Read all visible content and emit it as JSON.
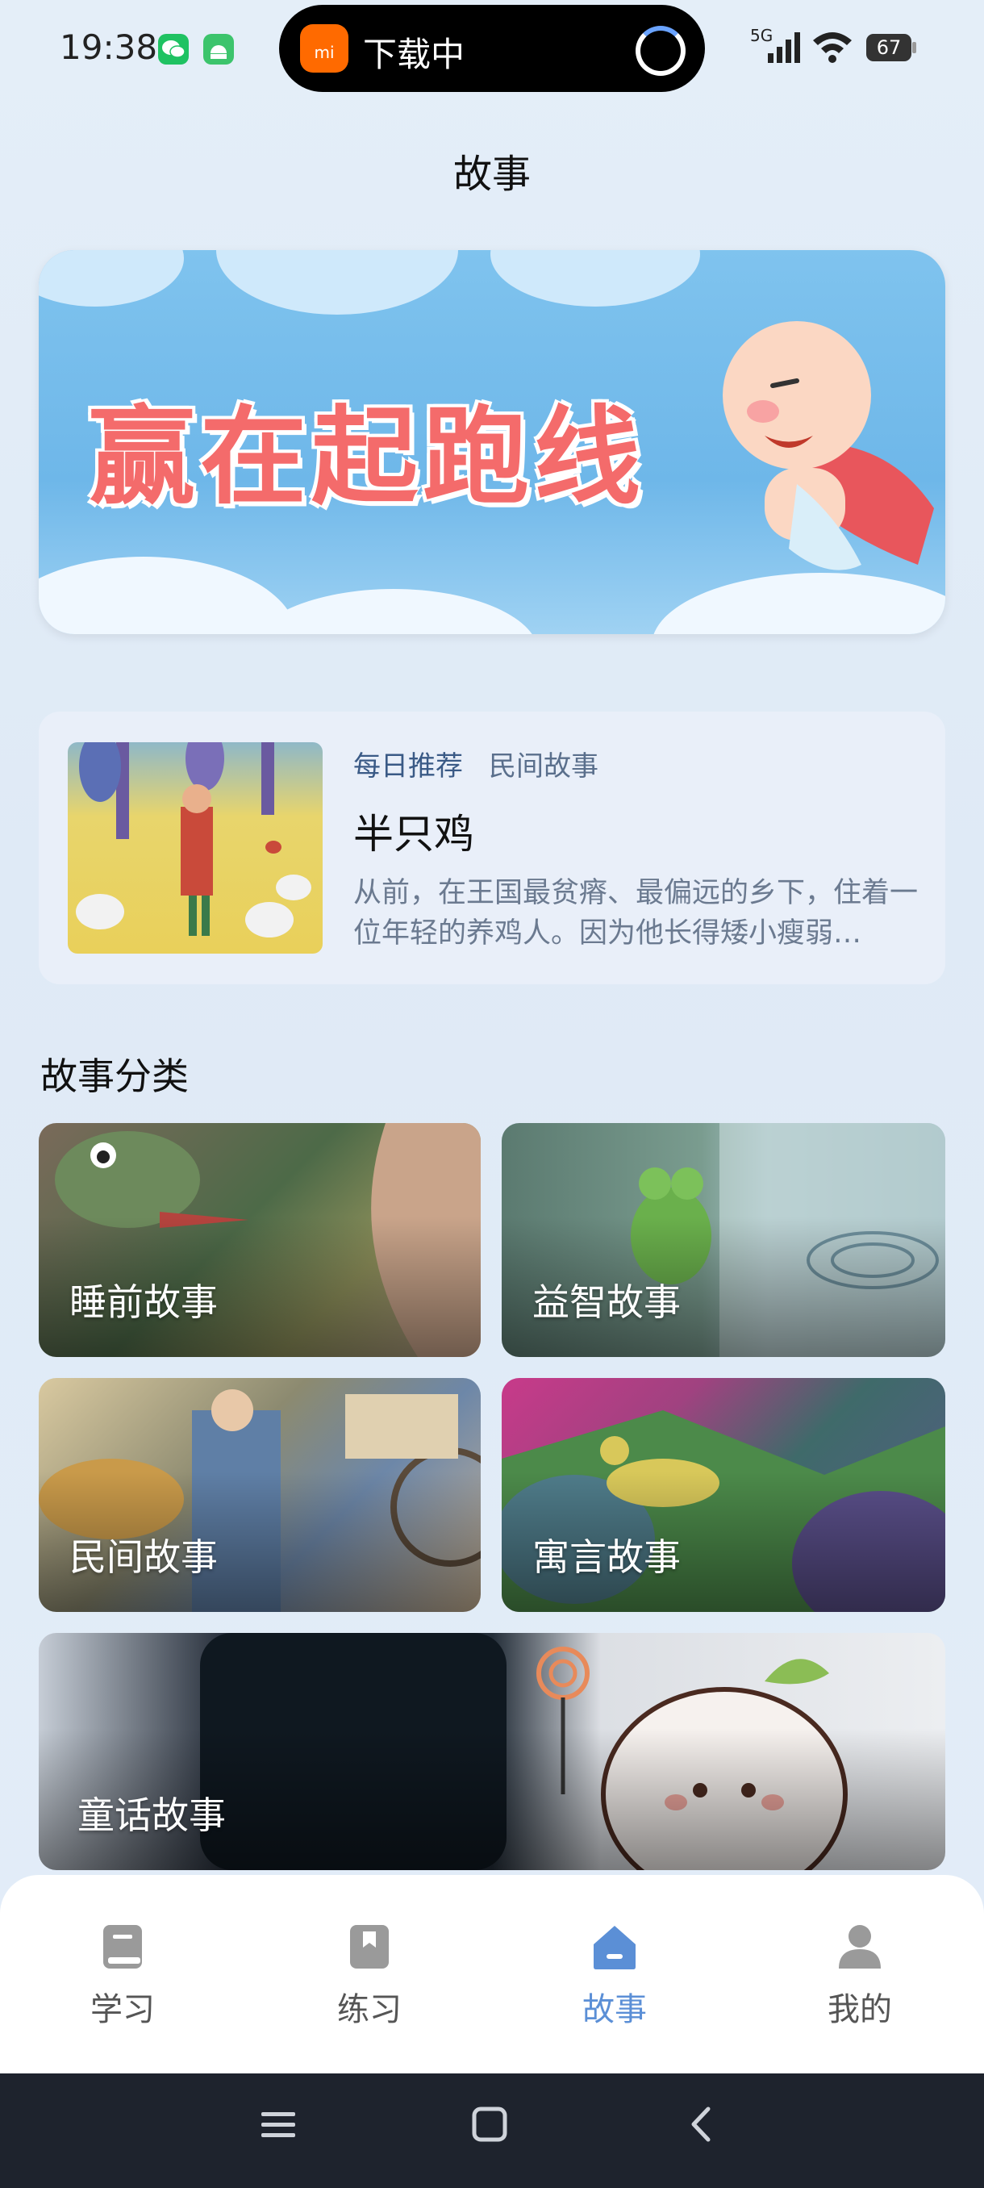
{
  "status_bar": {
    "time": "19:38",
    "download_label": "下载中",
    "download_app_text": "mi",
    "network": "5G",
    "battery": "67"
  },
  "header": {
    "title": "故事"
  },
  "banner": {
    "text": "赢在起跑线"
  },
  "recommendation": {
    "tag_daily": "每日推荐",
    "tag_category": "民间故事",
    "title": "半只鸡",
    "description": "从前，在王国最贫瘠、最偏远的乡下，住着一位年轻的养鸡人。因为他长得矮小瘦弱…"
  },
  "categories": {
    "title": "故事分类",
    "items": [
      {
        "label": "睡前故事"
      },
      {
        "label": "益智故事"
      },
      {
        "label": "民间故事"
      },
      {
        "label": "寓言故事"
      },
      {
        "label": "童话故事"
      }
    ]
  },
  "nav": {
    "items": [
      {
        "label": "学习",
        "icon": "book-icon"
      },
      {
        "label": "练习",
        "icon": "bookmark-icon"
      },
      {
        "label": "故事",
        "icon": "home-icon",
        "active": true
      },
      {
        "label": "我的",
        "icon": "user-icon"
      }
    ],
    "active_color": "#5b8fd6",
    "inactive_color": "#9a9a9a"
  }
}
